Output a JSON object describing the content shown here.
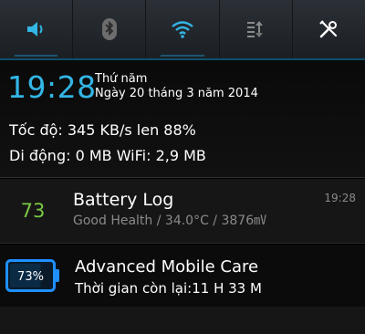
{
  "toggles": [
    {
      "name": "sound-icon",
      "on": true,
      "color": "#33b5e5"
    },
    {
      "name": "bluetooth-icon",
      "on": false,
      "color": "#8a8a8a"
    },
    {
      "name": "wifi-icon",
      "on": true,
      "color": "#33b5e5"
    },
    {
      "name": "data-sync-icon",
      "on": false,
      "color": "#8a8a8a"
    },
    {
      "name": "settings-tools-icon",
      "on": false,
      "color": "#ffffff"
    }
  ],
  "status": {
    "clock": "19:28",
    "weekday": "Thứ năm",
    "date": "Ngày 20 tháng 3 năm 2014",
    "speed_line": "Tốc độ: 345 KB/s   len 88%",
    "usage_line": "Di động: 0 MB   WiFi: 2,9 MB"
  },
  "notifications": [
    {
      "badge": "73",
      "title": "Battery Log",
      "subtitle": "Good Health / 34.0°C / 3876㎷",
      "time": "19:28"
    },
    {
      "battery_percent": "73%",
      "battery_level": 0.73,
      "title": "Advanced Mobile Care",
      "subtitle": "Thời gian còn lại:11 H 33 M"
    }
  ]
}
